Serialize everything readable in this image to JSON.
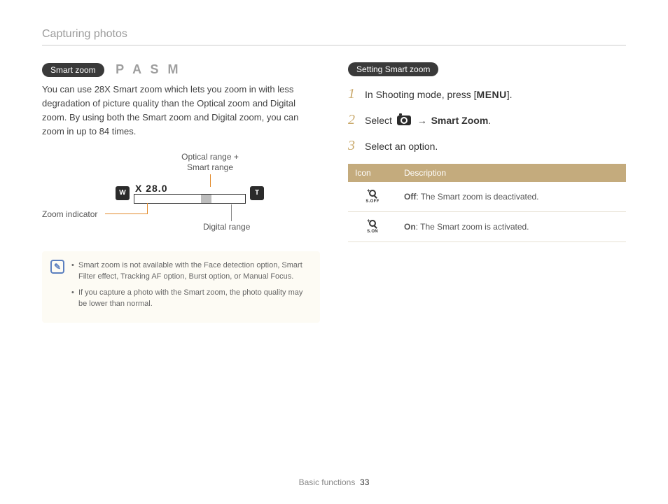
{
  "breadcrumb": "Capturing photos",
  "left": {
    "pill": "Smart zoom",
    "modes": "P A S M",
    "paragraph": "You can use 28X Smart zoom which lets you zoom in with less degradation of picture quality than the Optical zoom and Digital zoom. By using both the Smart zoom and Digital zoom, you can zoom in up to 84 times.",
    "diagram": {
      "optical_label_l1": "Optical range +",
      "optical_label_l2": "Smart range",
      "w_key": "W",
      "t_key": "T",
      "zoom_readout": "X 28.0",
      "zoom_indicator_label": "Zoom indicator",
      "digital_label": "Digital range"
    },
    "notes": [
      "Smart zoom is not available with the Face detection option, Smart Filter effect, Tracking AF option, Burst option, or Manual Focus.",
      "If you capture a photo with the Smart zoom, the photo quality may be lower than normal."
    ]
  },
  "right": {
    "pill": "Setting Smart zoom",
    "steps": {
      "s1_pre": "In Shooting mode, press [",
      "s1_menu": "MENU",
      "s1_post": "].",
      "s2_pre": "Select ",
      "s2_arrow": "→",
      "s2_bold": "Smart Zoom",
      "s2_post": ".",
      "s3": "Select an option."
    },
    "table": {
      "h_icon": "Icon",
      "h_desc": "Description",
      "rows": [
        {
          "sub": "S.OFF",
          "bold": "Off",
          "text": ": The Smart zoom is deactivated."
        },
        {
          "sub": "S.ON",
          "bold": "On",
          "text": ": The Smart zoom is activated."
        }
      ]
    }
  },
  "footer": {
    "section": "Basic functions",
    "page": "33"
  }
}
